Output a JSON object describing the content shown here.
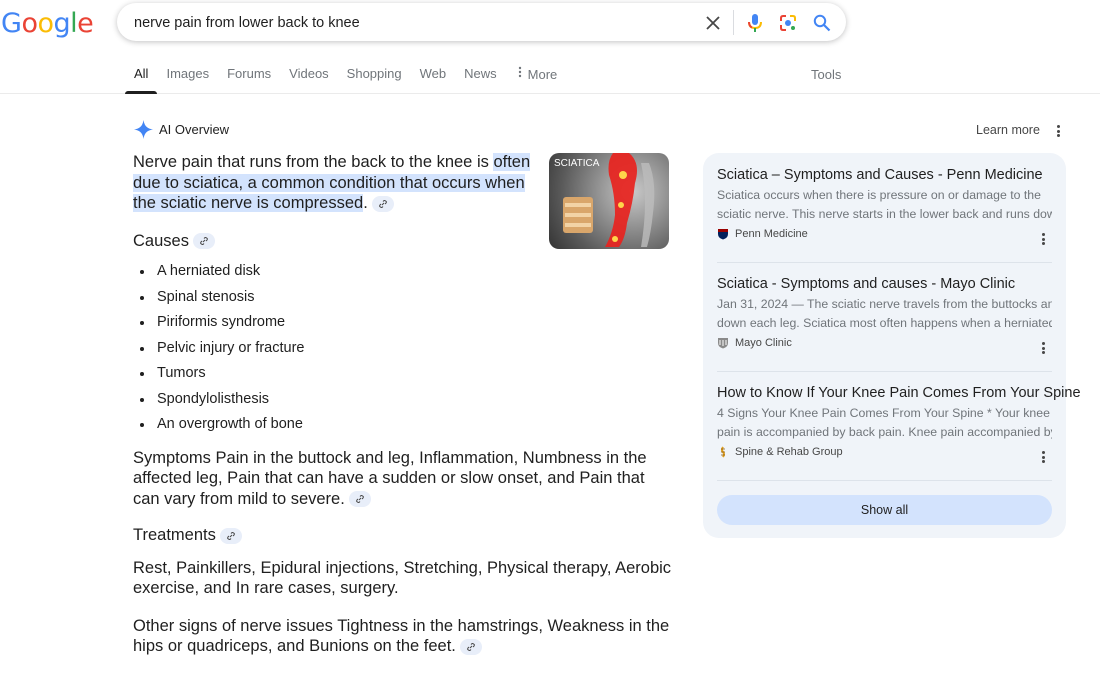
{
  "logo": {
    "letters": [
      "G",
      "o",
      "o",
      "g",
      "l",
      "e"
    ],
    "colors": [
      "#4285f4",
      "#ea4335",
      "#fbbc05",
      "#4285f4",
      "#34a853",
      "#ea4335"
    ]
  },
  "search": {
    "query": "nerve pain from lower back to knee",
    "icons": [
      "close-icon",
      "microphone-icon",
      "lens-icon",
      "search-icon"
    ]
  },
  "tabs": [
    {
      "label": "All",
      "active": true
    },
    {
      "label": "Images"
    },
    {
      "label": "Forums"
    },
    {
      "label": "Videos"
    },
    {
      "label": "Shopping"
    },
    {
      "label": "Web"
    },
    {
      "label": "News"
    },
    {
      "label": "More",
      "icon": "kebab-icon"
    }
  ],
  "tools_label": "Tools",
  "ai_overview": {
    "title": "AI Overview",
    "learn_more": "Learn more",
    "intro_plain": "Nerve pain that runs from the back to the knee is ",
    "intro_highlight_bold": "often due to sciatica, a common condition that occurs when the sciatic nerve is compressed",
    "intro_end": ".",
    "image_label": "SCIATICA",
    "causes_heading": "Causes",
    "causes": [
      "A herniated disk",
      "Spinal stenosis",
      "Piriformis syndrome",
      "Pelvic injury or fracture",
      "Tumors",
      "Spondylolisthesis",
      "An overgrowth of bone"
    ],
    "symptoms_text": "Symptoms Pain in the buttock and leg, Inflammation, Numbness in the affected leg, Pain that can have a sudden or slow onset, and Pain that can vary from mild to severe.",
    "treatments_heading": "Treatments",
    "treatments_text": "Rest, Painkillers, Epidural injections, Stretching, Physical therapy, Aerobic exercise, and In rare cases, surgery.",
    "other_signs_text": "Other signs of nerve issues Tightness in the hamstrings, Weakness in the hips or quadriceps, and Bunions on the feet."
  },
  "sources": {
    "items": [
      {
        "title": "Sciatica – Symptoms and Causes - Penn Medicine",
        "snippet_line1": "Sciatica occurs when there is pressure on or damage to the",
        "snippet_line2": "sciatic nerve. This nerve starts in the lower back and runs dow...",
        "site": "Penn Medicine",
        "favicon_color": "#011f5b"
      },
      {
        "title": "Sciatica - Symptoms and causes - Mayo Clinic",
        "snippet_line1": "Jan 31, 2024 — The sciatic nerve travels from the buttocks and",
        "snippet_line2": "down each leg. Sciatica most often happens when a herniated...",
        "site": "Mayo Clinic",
        "favicon_color": "#8a8a8a"
      },
      {
        "title": "How to Know If Your Knee Pain Comes From Your Spine",
        "snippet_line1": "4 Signs Your Knee Pain Comes From Your Spine * Your knee",
        "snippet_line2": "pain is accompanied by back pain. Knee pain accompanied by...",
        "site": "Spine & Rehab Group",
        "favicon_color": "#e0a020"
      }
    ],
    "show_all": "Show all"
  }
}
